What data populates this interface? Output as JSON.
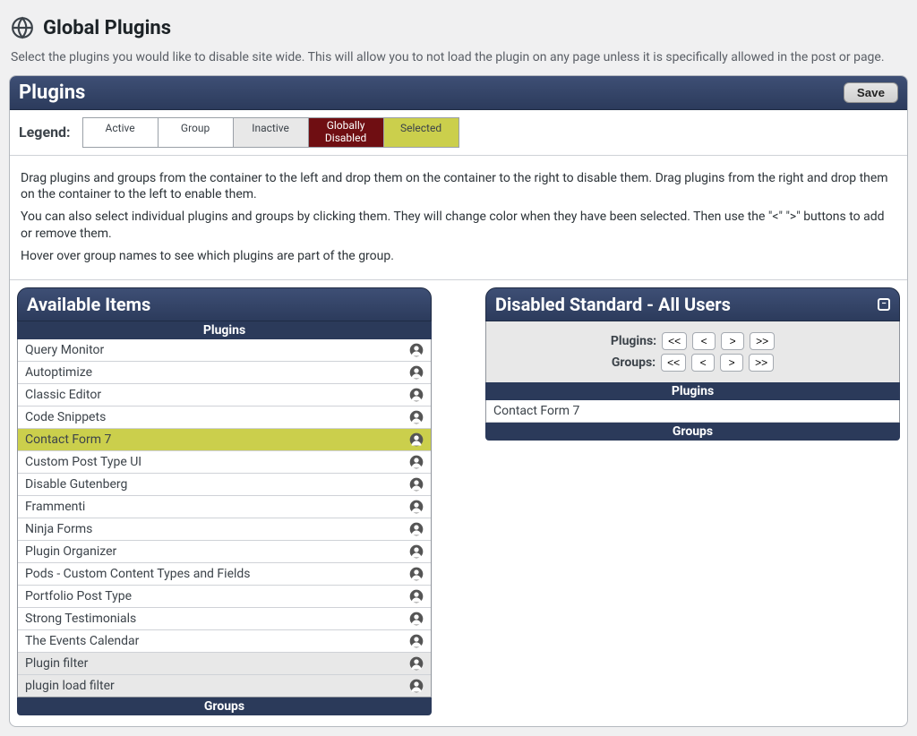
{
  "header": {
    "title": "Global Plugins"
  },
  "intro": "Select the plugins you would like to disable site wide. This will allow you to not load the plugin on any page unless it is specifically allowed in the post or page.",
  "panel": {
    "title": "Plugins",
    "save_label": "Save",
    "legend_label": "Legend:",
    "legend": {
      "active": "Active",
      "group": "Group",
      "inactive": "Inactive",
      "disabled": "Globally Disabled",
      "selected": "Selected"
    },
    "help": {
      "p1": "Drag plugins and groups from the container to the left and drop them on the container to the right to disable them. Drag plugins from the right and drop them on the container to the left to enable them.",
      "p2": "You can also select individual plugins and groups by clicking them. They will change color when they have been selected. Then use the \"<\" \">\" buttons to add or remove them.",
      "p3": "Hover over group names to see which plugins are part of the group."
    }
  },
  "available": {
    "title": "Available Items",
    "plugins_header": "Plugins",
    "groups_header": "Groups",
    "items": [
      {
        "label": "Query Monitor",
        "state": "active"
      },
      {
        "label": "Autoptimize",
        "state": "active"
      },
      {
        "label": "Classic Editor",
        "state": "active"
      },
      {
        "label": "Code Snippets",
        "state": "active"
      },
      {
        "label": "Contact Form 7",
        "state": "selected"
      },
      {
        "label": "Custom Post Type UI",
        "state": "active"
      },
      {
        "label": "Disable Gutenberg",
        "state": "active"
      },
      {
        "label": "Frammenti",
        "state": "active"
      },
      {
        "label": "Ninja Forms",
        "state": "active"
      },
      {
        "label": "Plugin Organizer",
        "state": "active"
      },
      {
        "label": "Pods - Custom Content Types and Fields",
        "state": "active"
      },
      {
        "label": "Portfolio Post Type",
        "state": "active"
      },
      {
        "label": "Strong Testimonials",
        "state": "active"
      },
      {
        "label": "The Events Calendar",
        "state": "active"
      },
      {
        "label": "Plugin filter",
        "state": "inactive"
      },
      {
        "label": "plugin load filter",
        "state": "inactive"
      }
    ]
  },
  "disabled": {
    "title": "Disabled Standard - All Users",
    "plugins_label": "Plugins:",
    "groups_label": "Groups:",
    "buttons": {
      "all_left": "<<",
      "left": "<",
      "right": ">",
      "all_right": ">>"
    },
    "plugins_header": "Plugins",
    "groups_header": "Groups",
    "items": [
      {
        "label": "Contact Form 7"
      }
    ]
  }
}
